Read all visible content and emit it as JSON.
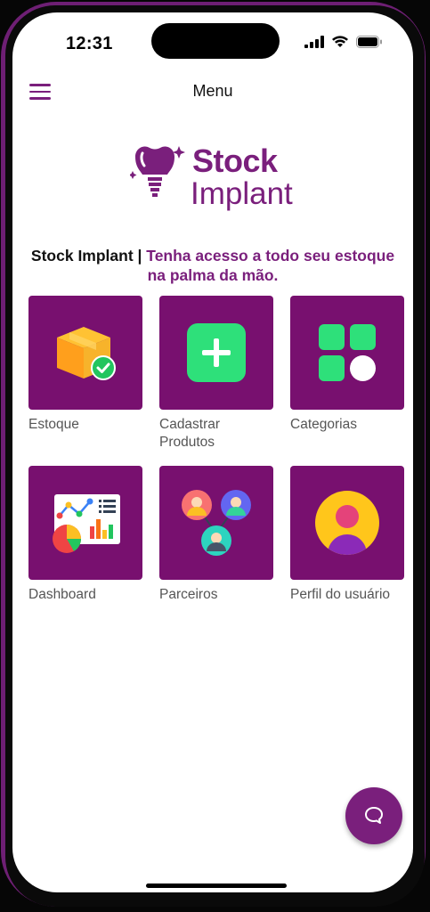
{
  "status_bar": {
    "time": "12:31",
    "icons": [
      "cellular-signal-icon",
      "wifi-icon",
      "battery-icon"
    ]
  },
  "header": {
    "title": "Menu",
    "menu_icon": "hamburger-menu-icon"
  },
  "logo": {
    "line1": "Stock",
    "line2": "Implant",
    "icon": "tooth-implant-icon"
  },
  "tagline": {
    "part1": "Stock Implant | ",
    "part2": "Tenha acesso a todo seu estoque na palma da mão."
  },
  "tiles": [
    {
      "label": "Estoque",
      "icon": "box-check-icon"
    },
    {
      "label": "Cadastrar Produtos",
      "icon": "plus-square-icon"
    },
    {
      "label": "Categorias",
      "icon": "categories-grid-icon"
    },
    {
      "label": "Dashboard",
      "icon": "dashboard-chart-icon"
    },
    {
      "label": "Parceiros",
      "icon": "partners-network-icon"
    },
    {
      "label": "Perfil do usuário",
      "icon": "user-profile-icon"
    }
  ],
  "fab": {
    "icon": "chat-bubble-icon"
  },
  "colors": {
    "brand": "#7a1f7c",
    "tile_bg": "#78106f",
    "green": "#2ee07a",
    "yellow": "#ffc61b"
  }
}
